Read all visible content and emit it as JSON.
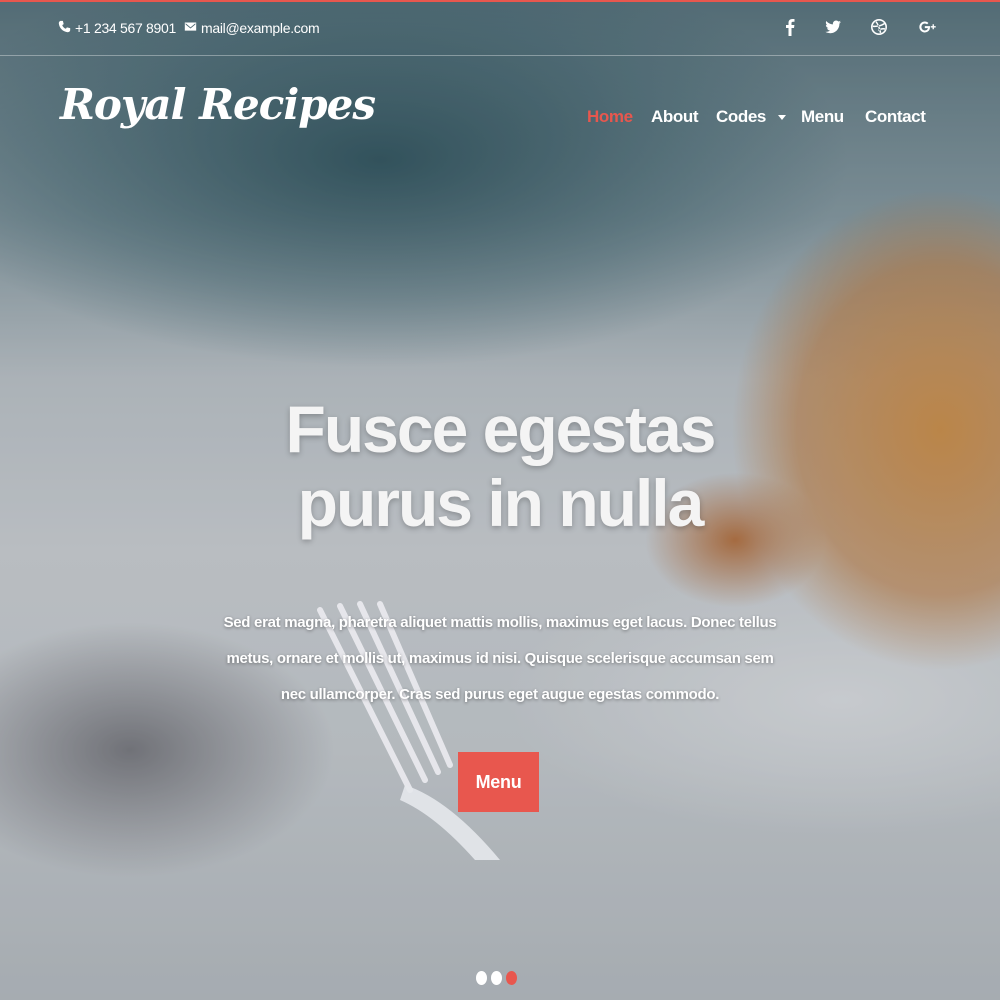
{
  "topbar": {
    "phone": "+1 234 567 8901",
    "email": "mail@example.com",
    "social": [
      {
        "icon": "facebook-icon"
      },
      {
        "icon": "twitter-icon"
      },
      {
        "icon": "dribbble-icon"
      },
      {
        "icon": "google-plus-icon"
      }
    ]
  },
  "header": {
    "logo": "Royal Recipes",
    "nav": [
      {
        "label": "Home",
        "active": true
      },
      {
        "label": "About"
      },
      {
        "label": "Codes",
        "dropdown": true
      },
      {
        "label": "Menu"
      },
      {
        "label": "Contact"
      }
    ]
  },
  "hero": {
    "title": "Fusce egestas purus in nulla",
    "text": "Sed erat magna, pharetra aliquet mattis mollis, maximus eget lacus. Donec tellus metus, ornare et mollis ut, maximus id nisi. Quisque scelerisque accumsan sem nec ullamcorper. Cras sed purus eget augue egestas commodo.",
    "button": "Menu"
  },
  "slider": {
    "slide_count": 3,
    "active_slide": 3
  },
  "colors": {
    "accent": "#e8574e",
    "text": "#ffffff"
  }
}
